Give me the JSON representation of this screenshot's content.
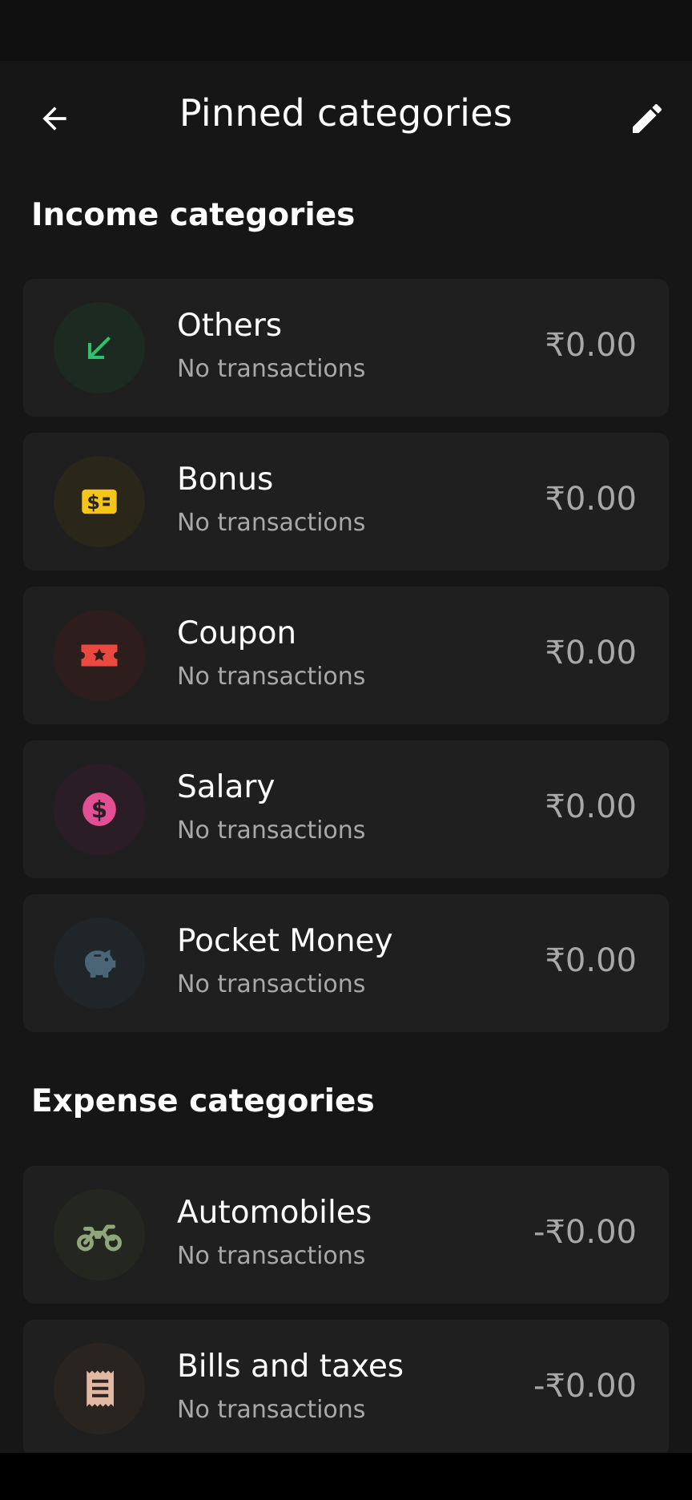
{
  "header": {
    "title": "Pinned categories",
    "back_icon": "arrow-left-icon",
    "edit_icon": "pencil-icon"
  },
  "income": {
    "title": "Income categories",
    "items": [
      {
        "name": "Others",
        "sub": "No transactions",
        "amount": "₹0.00",
        "icon": "arrow-down-left-icon",
        "color": "#2ec26b",
        "bg": "#1c2a22"
      },
      {
        "name": "Bonus",
        "sub": "No transactions",
        "amount": "₹0.00",
        "icon": "cash-icon",
        "color": "#f5c518",
        "bg": "#2a261a"
      },
      {
        "name": "Coupon",
        "sub": "No transactions",
        "amount": "₹0.00",
        "icon": "ticket-icon",
        "color": "#e9493f",
        "bg": "#2d1d1d"
      },
      {
        "name": "Salary",
        "sub": "No transactions",
        "amount": "₹0.00",
        "icon": "dollar-coin-icon",
        "color": "#e24f94",
        "bg": "#2b1d25"
      },
      {
        "name": "Pocket Money",
        "sub": "No transactions",
        "amount": "₹0.00",
        "icon": "piggy-bank-icon",
        "color": "#4a6676",
        "bg": "#1f2529"
      }
    ]
  },
  "expense": {
    "title": "Expense categories",
    "items": [
      {
        "name": "Automobiles",
        "sub": "No transactions",
        "amount": "-₹0.00",
        "icon": "motorcycle-icon",
        "color": "#8fa57a",
        "bg": "#24271f"
      },
      {
        "name": "Bills and taxes",
        "sub": "No transactions",
        "amount": "-₹0.00",
        "icon": "receipt-icon",
        "color": "#e2b8a2",
        "bg": "#2a2420"
      }
    ]
  }
}
